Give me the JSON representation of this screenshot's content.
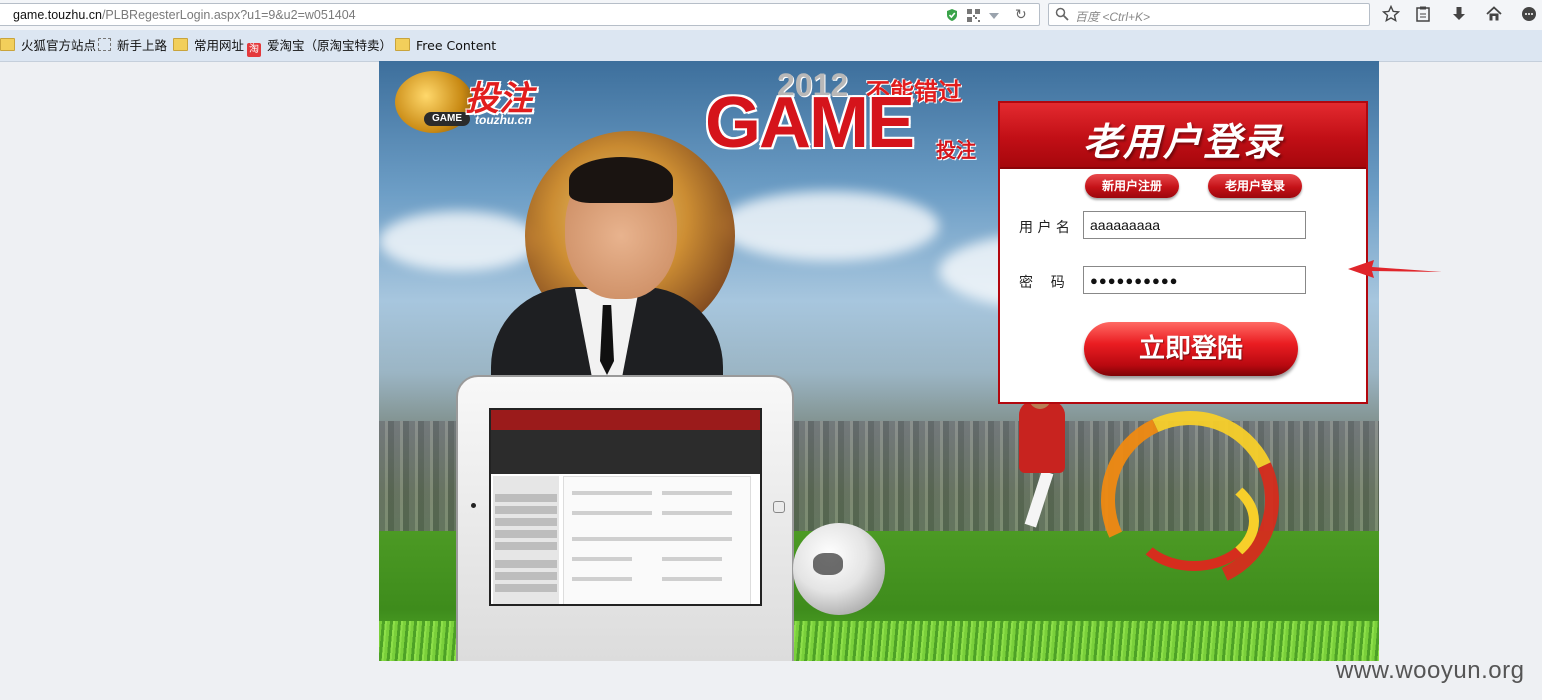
{
  "browser": {
    "url_host": "game.touzhu.cn",
    "url_path": "/PLBRegesterLogin.aspx?u1=9&u2=w051404",
    "search_placeholder": "百度 <Ctrl+K>",
    "bookmarks": [
      {
        "label": "火狐官方站点",
        "icon": "folder-icon"
      },
      {
        "label": "新手上路",
        "icon": "dashed-page-icon"
      },
      {
        "label": "常用网址",
        "icon": "folder-icon"
      },
      {
        "label": "爱淘宝（原淘宝特卖）",
        "icon": "taobao-icon"
      },
      {
        "label": "Free Content",
        "icon": "folder-icon"
      }
    ],
    "toolbar_icons": [
      "star-icon",
      "reading-list-icon",
      "download-icon",
      "home-icon",
      "chat-icon"
    ]
  },
  "banner": {
    "logo_cn": "投注",
    "logo_game": "GAME",
    "logo_domain": "touzhu.cn",
    "headline_year": "2012",
    "headline_cant_miss": "不能错过",
    "headline_game": "GAME",
    "headline_touzhu": "投注"
  },
  "login": {
    "title": "老用户登录",
    "tab_register": "新用户注册",
    "tab_login": "老用户登录",
    "username_label": "用 户 名",
    "username_value": "aaaaaaaaa",
    "password_label": "密    码",
    "password_value": "●●●●●●●●●●",
    "submit_label": "立即登陆"
  },
  "colors": {
    "accent_red": "#c10f16",
    "page_bg": "#eef0f3"
  },
  "watermark": "www.wooyun.org"
}
